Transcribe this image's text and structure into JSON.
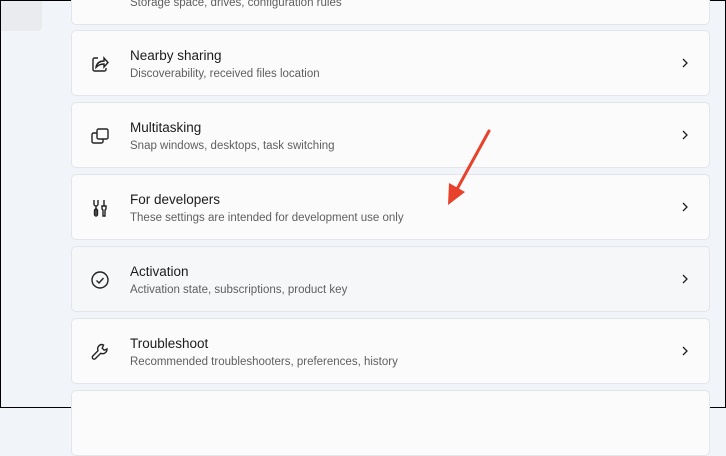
{
  "cards": [
    {
      "title": "",
      "subtitle": "Storage space, drives, configuration rules"
    },
    {
      "title": "Nearby sharing",
      "subtitle": "Discoverability, received files location",
      "icon": "share-icon"
    },
    {
      "title": "Multitasking",
      "subtitle": "Snap windows, desktops, task switching",
      "icon": "multitasking-icon"
    },
    {
      "title": "For developers",
      "subtitle": "These settings are intended for development use only",
      "icon": "developer-tools-icon"
    },
    {
      "title": "Activation",
      "subtitle": "Activation state, subscriptions, product key",
      "icon": "checkmark-circle-icon"
    },
    {
      "title": "Troubleshoot",
      "subtitle": "Recommended troubleshooters, preferences, history",
      "icon": "wrench-icon"
    }
  ],
  "annotation_color": "#e8412c"
}
